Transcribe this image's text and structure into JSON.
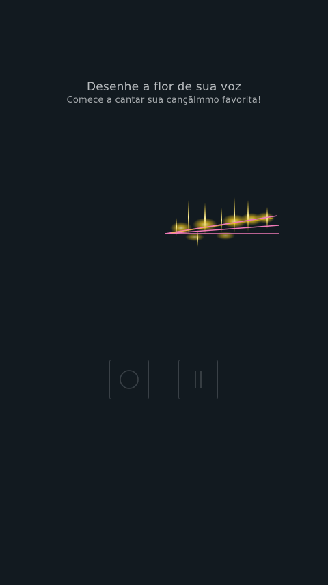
{
  "header": {
    "title": "Desenhe a flor de sua voz",
    "subtitle": "Comece a cantar sua cançãlmmo favorita!"
  },
  "controls": {
    "restart_icon": "restart-circle-icon",
    "pause_icon": "pause-icon"
  },
  "colors": {
    "background": "#121a20",
    "stroke_pink": "#f07ab8",
    "sparkle_gold": "#ffd21a",
    "button_border": "#3a4147"
  }
}
